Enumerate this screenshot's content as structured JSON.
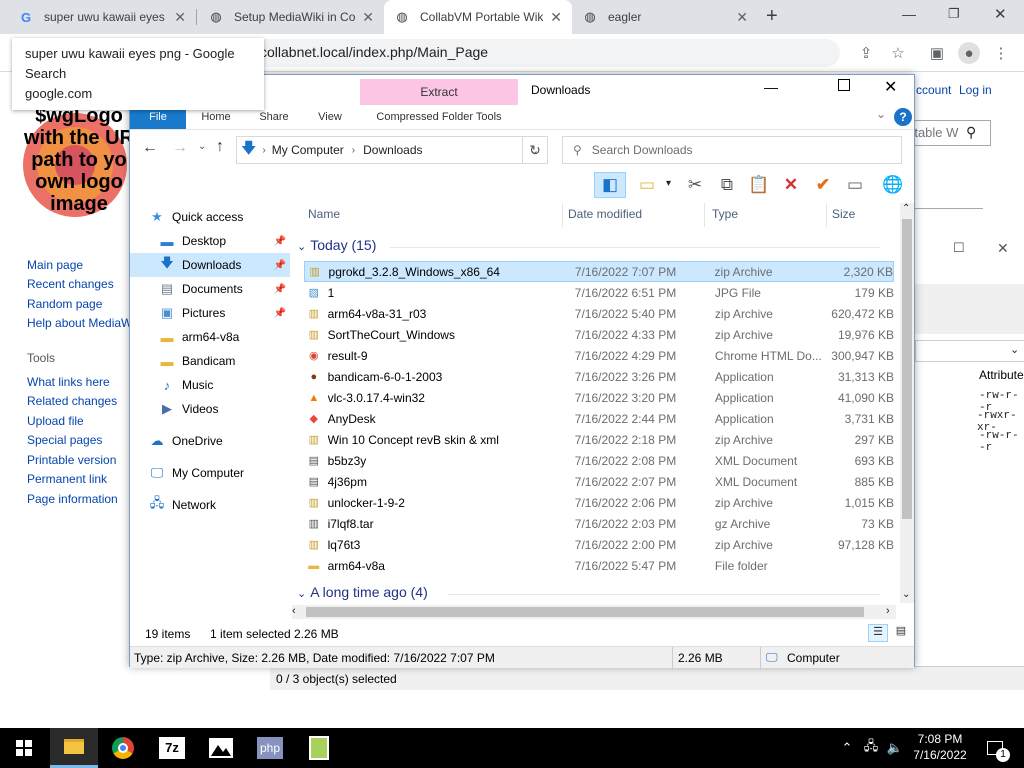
{
  "browser": {
    "tabs": [
      {
        "title": "super uwu kawaii eyes",
        "icon": "google-icon"
      },
      {
        "title": "Setup MediaWiki in Co",
        "icon": "globe-icon"
      },
      {
        "title": "CollabVM Portable Wik",
        "icon": "globe-icon"
      },
      {
        "title": "eagler",
        "icon": "globe-icon"
      }
    ],
    "new_tab": "+",
    "url": "collabnet.local/index.php/Main_Page",
    "tooltip": {
      "title": "super uwu kawaii eyes png - Google Search",
      "url": "google.com"
    }
  },
  "wiki": {
    "logo_text": [
      "$wgLogo",
      "with the UR",
      "path to yo",
      "own logo",
      "image"
    ],
    "top_links": {
      "account": "ccount",
      "login": "Log in"
    },
    "search_placeholder": "rtable W",
    "nav": [
      "Main page",
      "Recent changes",
      "Random page",
      "Help about MediaW"
    ],
    "tools_heading": "Tools",
    "tools": [
      "What links here",
      "Related changes",
      "Upload file",
      "Special pages",
      "Printable version",
      "Permanent link",
      "Page information"
    ]
  },
  "back_window": {
    "attr_header": "Attribute",
    "attrs": [
      "-rw-r--r",
      "-rwxr-xr-",
      "-rw-r--r"
    ],
    "status": "0 / 3 object(s) selected"
  },
  "explorer": {
    "title": "Downloads",
    "context_tab": "Extract",
    "tabs": [
      "File",
      "Home",
      "Share",
      "View",
      "Compressed Folder Tools"
    ],
    "address": [
      "My Computer",
      "Downloads"
    ],
    "search_placeholder": "Search Downloads",
    "nav": [
      {
        "label": "Quick access",
        "icon": "star-icon",
        "pinned": false,
        "selected": false
      },
      {
        "label": "Desktop",
        "icon": "desktop-icon",
        "pinned": true,
        "selected": false
      },
      {
        "label": "Downloads",
        "icon": "download-icon",
        "pinned": true,
        "selected": true
      },
      {
        "label": "Documents",
        "icon": "document-icon",
        "pinned": true,
        "selected": false
      },
      {
        "label": "Pictures",
        "icon": "pictures-icon",
        "pinned": true,
        "selected": false
      },
      {
        "label": "arm64-v8a",
        "icon": "folder-icon",
        "pinned": false,
        "selected": false
      },
      {
        "label": "Bandicam",
        "icon": "folder-icon",
        "pinned": false,
        "selected": false
      },
      {
        "label": "Music",
        "icon": "music-icon",
        "pinned": false,
        "selected": false
      },
      {
        "label": "Videos",
        "icon": "video-icon",
        "pinned": false,
        "selected": false
      },
      {
        "label": "OneDrive",
        "icon": "cloud-icon",
        "pinned": false,
        "selected": false
      },
      {
        "label": "My Computer",
        "icon": "computer-icon",
        "pinned": false,
        "selected": false
      },
      {
        "label": "Network",
        "icon": "network-icon",
        "pinned": false,
        "selected": false
      }
    ],
    "columns": [
      "Name",
      "Date modified",
      "Type",
      "Size"
    ],
    "group_today": "Today (15)",
    "group_old": "A long time ago (4)",
    "files": [
      {
        "name": "pgrokd_3.2.8_Windows_x86_64",
        "date": "7/16/2022 7:07 PM",
        "type": "zip Archive",
        "size": "2,320 KB",
        "icon": "zip-icon",
        "selected": true
      },
      {
        "name": "1",
        "date": "7/16/2022 6:51 PM",
        "type": "JPG File",
        "size": "179 KB",
        "icon": "image-file-icon",
        "selected": false
      },
      {
        "name": "arm64-v8a-31_r03",
        "date": "7/16/2022 5:40 PM",
        "type": "zip Archive",
        "size": "620,472 KB",
        "icon": "zip-icon",
        "selected": false
      },
      {
        "name": "SortTheCourt_Windows",
        "date": "7/16/2022 4:33 PM",
        "type": "zip Archive",
        "size": "19,976 KB",
        "icon": "zip-icon",
        "selected": false
      },
      {
        "name": "result-9",
        "date": "7/16/2022 4:29 PM",
        "type": "Chrome HTML Do...",
        "size": "300,947 KB",
        "icon": "chrome-icon",
        "selected": false
      },
      {
        "name": "bandicam-6-0-1-2003",
        "date": "7/16/2022 3:26 PM",
        "type": "Application",
        "size": "31,313 KB",
        "icon": "bandicam-icon",
        "selected": false
      },
      {
        "name": "vlc-3.0.17.4-win32",
        "date": "7/16/2022 3:20 PM",
        "type": "Application",
        "size": "41,090 KB",
        "icon": "vlc-icon",
        "selected": false
      },
      {
        "name": "AnyDesk",
        "date": "7/16/2022 2:44 PM",
        "type": "Application",
        "size": "3,731 KB",
        "icon": "anydesk-icon",
        "selected": false
      },
      {
        "name": "Win 10 Concept revB skin & xml",
        "date": "7/16/2022 2:18 PM",
        "type": "zip Archive",
        "size": "297 KB",
        "icon": "zip-icon",
        "selected": false
      },
      {
        "name": "b5bz3y",
        "date": "7/16/2022 2:08 PM",
        "type": "XML Document",
        "size": "693 KB",
        "icon": "xml-icon",
        "selected": false
      },
      {
        "name": "4j36pm",
        "date": "7/16/2022 2:07 PM",
        "type": "XML Document",
        "size": "885 KB",
        "icon": "xml-icon",
        "selected": false
      },
      {
        "name": "unlocker-1-9-2",
        "date": "7/16/2022 2:06 PM",
        "type": "zip Archive",
        "size": "1,015 KB",
        "icon": "zip-icon",
        "selected": false
      },
      {
        "name": "i7lqf8.tar",
        "date": "7/16/2022 2:03 PM",
        "type": "gz Archive",
        "size": "73 KB",
        "icon": "archive-icon",
        "selected": false
      },
      {
        "name": "lq76t3",
        "date": "7/16/2022 2:00 PM",
        "type": "zip Archive",
        "size": "97,128 KB",
        "icon": "zip-icon",
        "selected": false
      },
      {
        "name": "arm64-v8a",
        "date": "7/16/2022 5:47 PM",
        "type": "File folder",
        "size": "",
        "icon": "folder-icon",
        "selected": false
      }
    ],
    "status": {
      "items": "19 items",
      "selected": "1 item selected",
      "size": "2.26 MB"
    },
    "details": {
      "info": "Type: zip Archive, Size: 2.26 MB, Date modified: 7/16/2022 7:07 PM",
      "size": "2.26 MB",
      "location": "Computer"
    }
  },
  "taskbar": {
    "apps": [
      "explorer-icon",
      "chrome-icon",
      "7zip-icon",
      "photos-icon",
      "php-icon",
      "notepadpp-icon"
    ],
    "zip_label": "7z",
    "php_label": "php",
    "time": "7:08 PM",
    "date": "7/16/2022",
    "notifications": "1"
  },
  "colors": {
    "accent": "#0078d7",
    "selection": "#cce8ff",
    "extract_tab": "#fcc5e4"
  }
}
